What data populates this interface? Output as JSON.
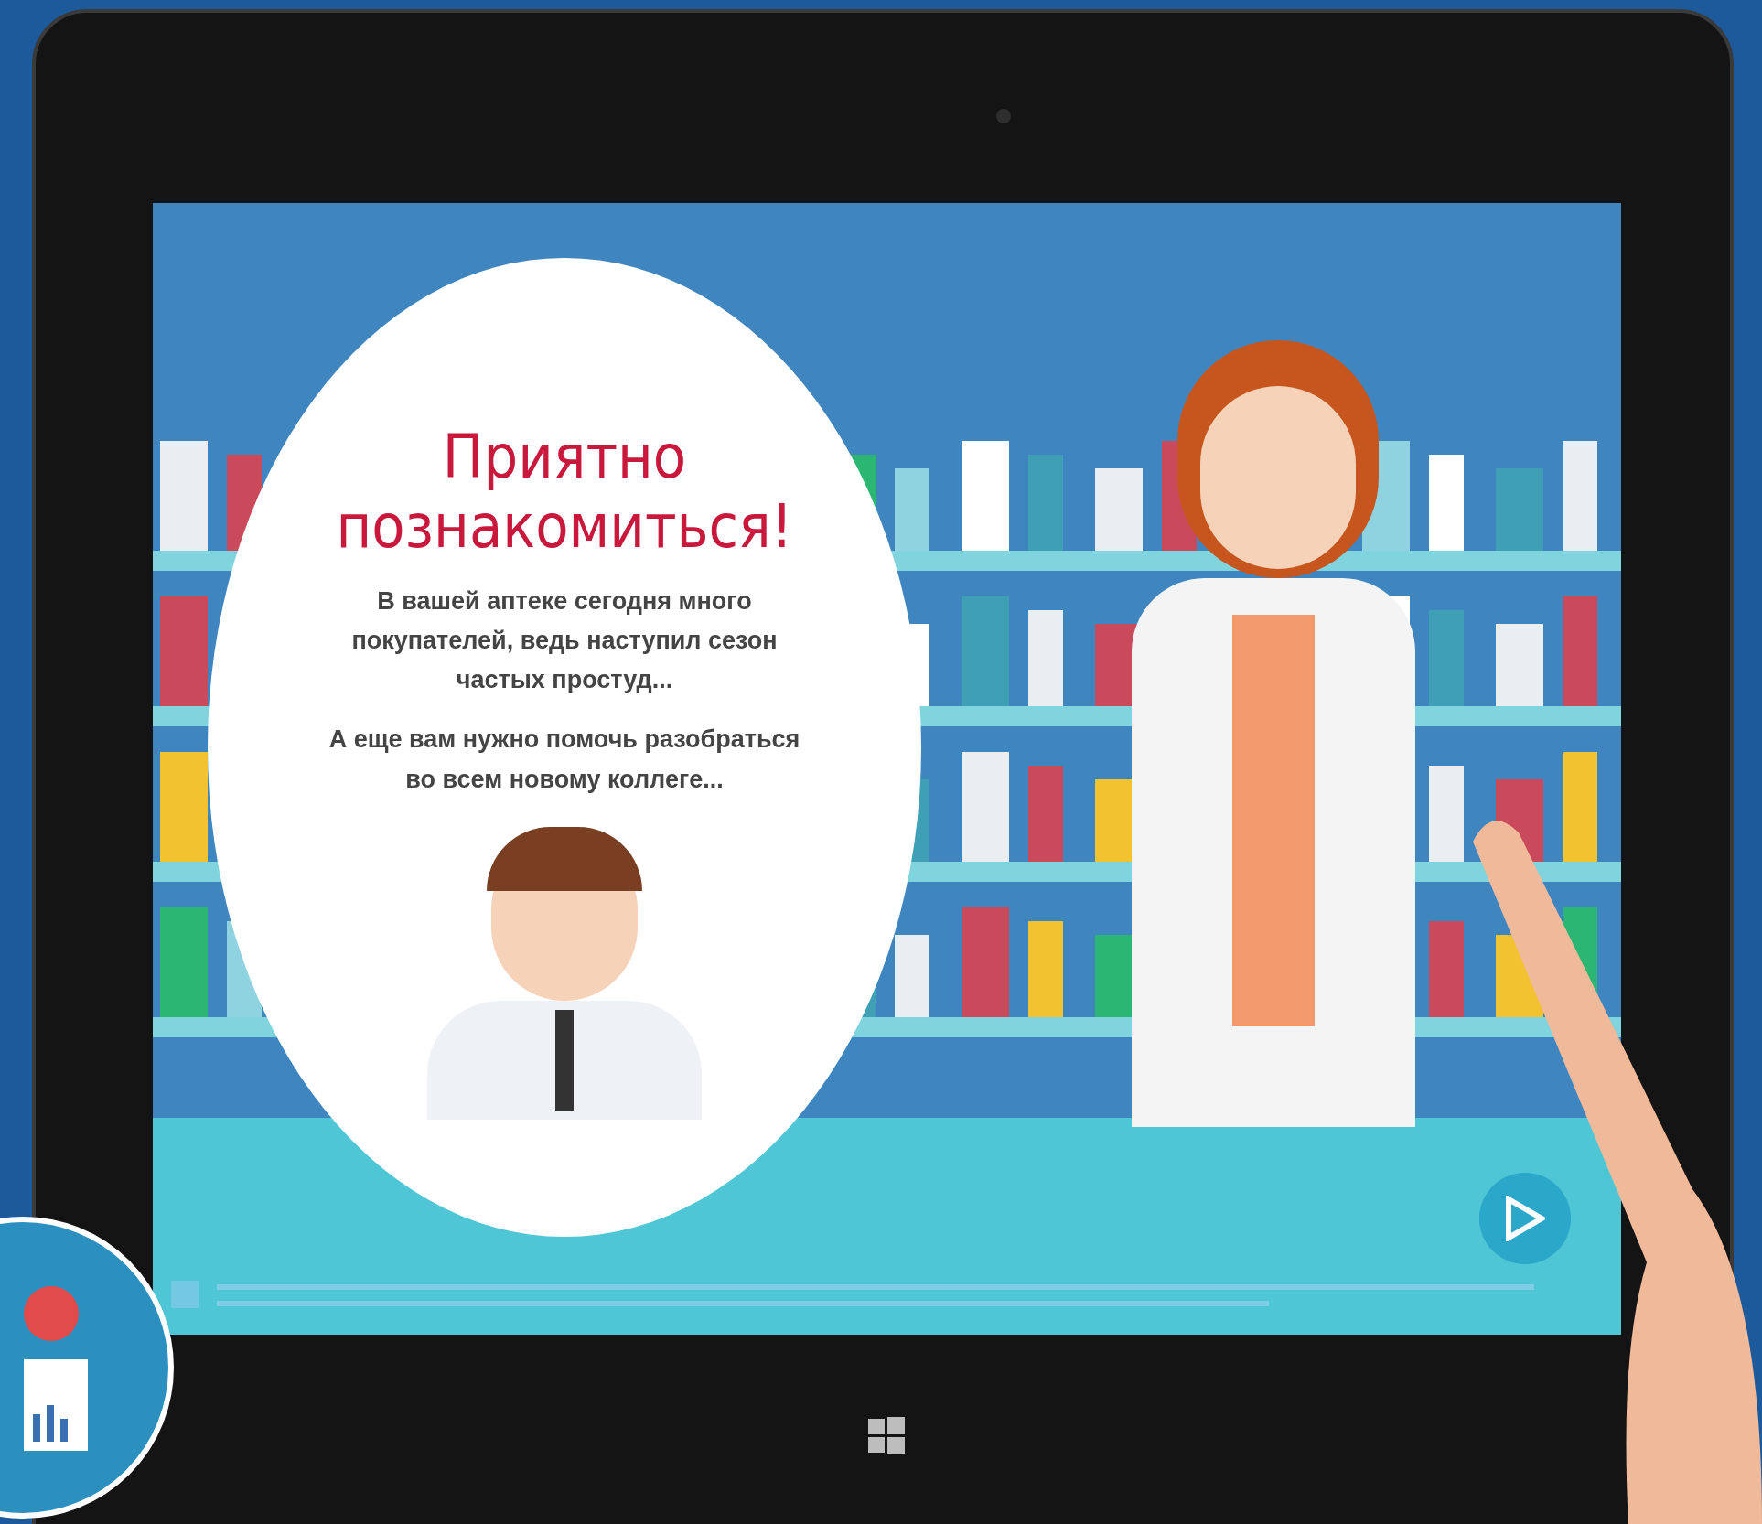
{
  "slide": {
    "title": "Приятно познакомиться!",
    "paragraphs": [
      "В вашей аптеке сегодня много покупателей, ведь наступил сезон частых простуд...",
      "А еще вам нужно помочь разобраться во всем новому коллеге..."
    ]
  }
}
